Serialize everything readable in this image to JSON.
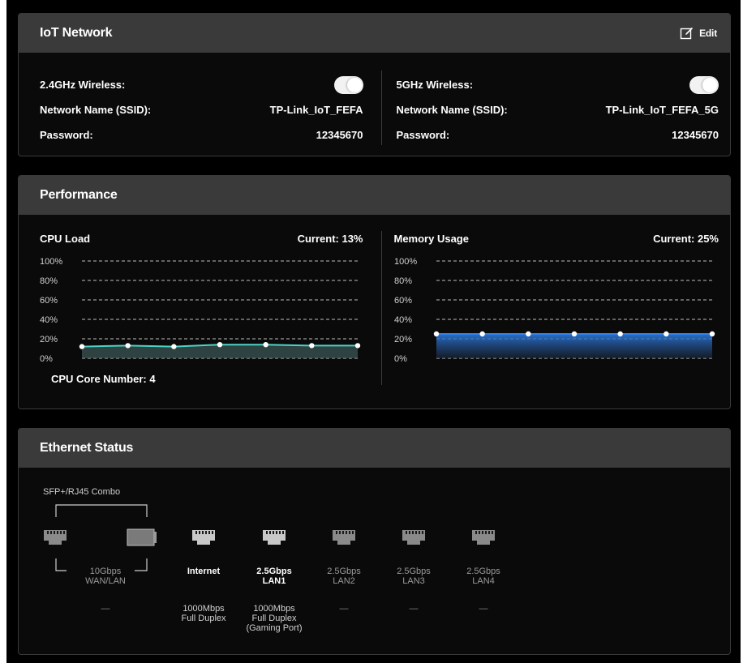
{
  "iot": {
    "title": "IoT Network",
    "edit_label": "Edit",
    "band24": {
      "label": "2.4GHz Wireless:",
      "ssid_label": "Network Name (SSID):",
      "ssid": "TP-Link_IoT_FEFA",
      "password_label": "Password:",
      "password": "12345670",
      "enabled": true
    },
    "band5": {
      "label": "5GHz Wireless:",
      "ssid_label": "Network Name (SSID):",
      "ssid": "TP-Link_IoT_FEFA_5G",
      "password_label": "Password:",
      "password": "12345670",
      "enabled": true
    }
  },
  "performance": {
    "title": "Performance",
    "cpu": {
      "label": "CPU Load",
      "current": "Current: 13%",
      "core_number": "CPU Core Number: 4",
      "y_ticks": [
        "100%",
        "80%",
        "60%",
        "40%",
        "20%",
        "0%"
      ],
      "values": [
        12,
        13,
        12,
        14,
        14,
        13,
        13
      ],
      "color": "#4fd1c5"
    },
    "memory": {
      "label": "Memory Usage",
      "current": "Current: 25%",
      "y_ticks": [
        "100%",
        "80%",
        "60%",
        "40%",
        "20%",
        "0%"
      ],
      "values": [
        25,
        25,
        25,
        25,
        25,
        25,
        25
      ],
      "color": "#2f80ed"
    }
  },
  "ethernet": {
    "title": "Ethernet Status",
    "combo_label": "SFP+/RJ45 Combo",
    "ports": [
      {
        "speed": "10Gbps",
        "name": "WAN/LAN",
        "status": "—",
        "active": false
      },
      {
        "speed": "",
        "name": "Internet",
        "status": "1000Mbps\nFull Duplex",
        "active": true
      },
      {
        "speed": "2.5Gbps",
        "name": "LAN1",
        "status": "1000Mbps\nFull Duplex\n(Gaming Port)",
        "active": true
      },
      {
        "speed": "2.5Gbps",
        "name": "LAN2",
        "status": "—",
        "active": false
      },
      {
        "speed": "2.5Gbps",
        "name": "LAN3",
        "status": "—",
        "active": false
      },
      {
        "speed": "2.5Gbps",
        "name": "LAN4",
        "status": "—",
        "active": false
      }
    ]
  }
}
